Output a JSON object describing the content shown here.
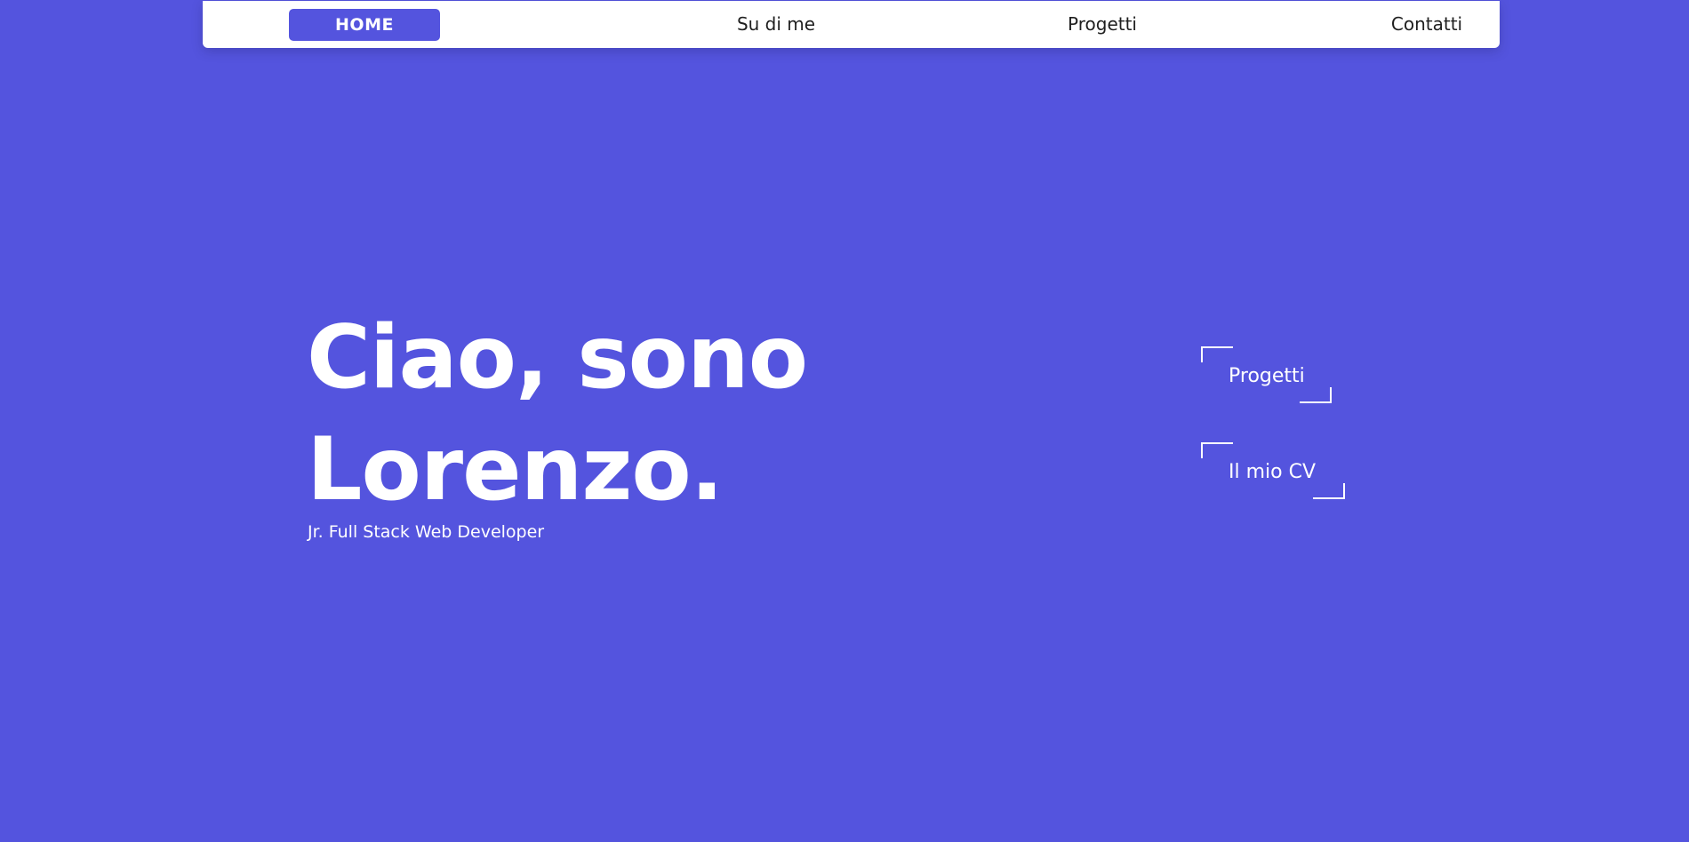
{
  "nav": {
    "home": "HOME",
    "about": "Su di me",
    "projects": "Progetti",
    "contacts": "Contatti"
  },
  "hero": {
    "title_line1": "Ciao, sono",
    "title_line2": "Lorenzo.",
    "subtitle": "Jr. Full Stack Web Developer"
  },
  "actions": {
    "projects_label": "Progetti",
    "cv_label": "Il mio CV"
  },
  "colors": {
    "background": "#5454DE",
    "navbar": "#FFFFFF",
    "accent": "#5454DE",
    "text_light": "#FFFFFF",
    "text_dark": "#1F1F1F"
  }
}
